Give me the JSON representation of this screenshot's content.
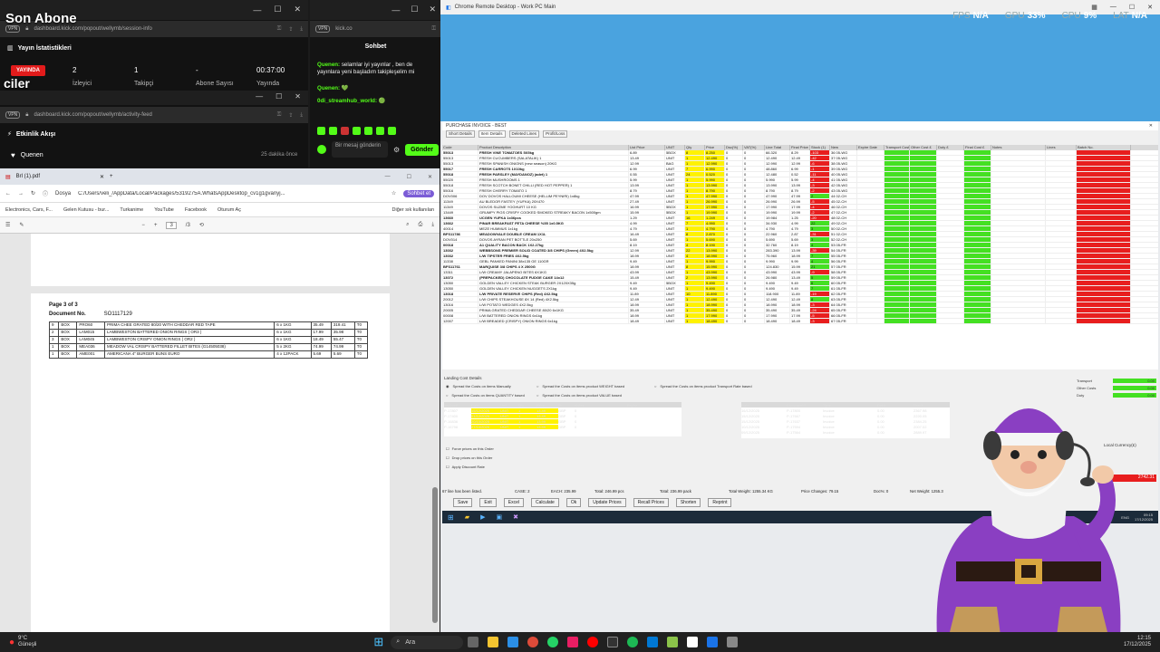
{
  "overlay": {
    "title": "Son Abone",
    "title_sub": "ciler"
  },
  "stats_window": {
    "url": "dashboard.kick.com/popout/wellymb/session-info",
    "vpn": "VPN",
    "heading": "Yayın İstatistikleri",
    "live_badge": "YAYINDA",
    "viewers_value": "2",
    "viewers_label": "İzleyici",
    "followers_value": "1",
    "followers_label": "Takipçi",
    "subs_value": "-",
    "subs_label": "Abone Sayısı",
    "time_value": "00:37:00",
    "time_label": "Yayında"
  },
  "activity_window": {
    "url": "dashboard.kick.com/popout/wellymb/activity-feed",
    "vpn": "VPN",
    "heading": "Etkinlik Akışı",
    "user": "Quenen",
    "time_ago": "25 dakika önce"
  },
  "chat": {
    "vpn": "VPN",
    "url": "kick.co",
    "heading": "Sohbet",
    "messages": [
      {
        "user": "Quenen:",
        "text": " selamlar iyi yayınlar , ben de yayınlara yeni başladım takipleşelim mi"
      },
      {
        "user": "Quenen:",
        "text": " 💚"
      },
      {
        "user": "0di_streamhub_world:",
        "text": " 🟢"
      }
    ],
    "input_placeholder": "Bir mesaj gönderin",
    "send_label": "Gönder"
  },
  "pdf": {
    "tab_title": "Brl (1).pdf",
    "address": "C:/Users/veli_/AppData/Local/Packages/5319275A.WhatsAppDesktop_cv1g1gvanyj...",
    "address_prefix": "Dosya",
    "chat_label": "Sohbet et",
    "bookmarks": [
      "Electronics, Cars, F...",
      "Gelen Kutusu - bur...",
      "Turkanime",
      "YouTube",
      "Facebook",
      "Oturum Aç"
    ],
    "other_bookmarks": "Diğer sık kullanılan",
    "page_input": "3",
    "page_total": "/3",
    "page_heading": "Page 3 of 3",
    "doc_label": "Document No.",
    "doc_number": "SO1117129",
    "rows": [
      [
        "9",
        "BOX",
        "PRO60",
        "PRIMA CHEE GRATED 80/20 WITH CHEDDAR RED TAPE",
        "6 x 1KG",
        "35.49",
        "319.41",
        "T0"
      ],
      [
        "2",
        "BOX",
        "LAM015",
        "LAMBWESTON BATTERED ONION RINGS ( OR3 )",
        "6 x 1KG",
        "17.99",
        "35.98",
        "T0"
      ],
      [
        "3",
        "BOX",
        "LAM045",
        "LAMBWESTON CRISPY ONION RINGS ( OR2 )",
        "6 x 1KG",
        "18.49",
        "55.47",
        "T0"
      ],
      [
        "1",
        "BOX",
        "MEA036",
        "MEADOW VAL CRISPY BATTERED FILLET BITES (G14505038)",
        "5 x 2KG",
        "74.99",
        "74.99",
        "T0"
      ],
      [
        "1",
        "BOX",
        "AME001",
        "AMERICANA 4\" BURGER BUNS EURO",
        "4 x 12PACK",
        "5.69",
        "5.69",
        "T0"
      ]
    ]
  },
  "crd": {
    "title": "Chrome Remote Desktop - Work PC Main",
    "hud": {
      "fps_label": "FPS",
      "fps_value": "N/A",
      "gpu_label": "GPU",
      "gpu_value": "33%",
      "cpu_label": "CPU",
      "cpu_value": "9%",
      "lat_label": "LAT",
      "lat_value": "N/A"
    },
    "invoice_title": "PURCHASE INVOICE - BEST",
    "tabs": [
      "Short Details",
      "Item Details",
      "Deleted Lines",
      "Profit/Loss"
    ],
    "columns": [
      "Code",
      "Product Description",
      "List Price",
      "UNIT",
      "Qty",
      "Price",
      "Dsc(%)",
      "VAT(%)",
      "Line Total",
      "Final Price",
      "Stock (1)",
      "New",
      "Expire Date",
      "Transport Cost £",
      "Other Cost £",
      "Duty £",
      "Final Cost £",
      "Notes",
      "Lines",
      "Batch No."
    ],
    "items": [
      [
        "55013",
        "FRESH VINE TOMATOES 5X5kg",
        "6.89",
        "5BOX",
        "8",
        "8.250",
        "0",
        "0",
        "66.320",
        "8.29",
        "-103",
        "36 05-WG"
      ],
      [
        "55013",
        "FRESH CUCUMBERS (SALATALIK) 1",
        "13.49",
        "UNIT",
        "1",
        "12.490",
        "0",
        "0",
        "12.490",
        "12.49",
        "-42",
        "37 05-WG"
      ],
      [
        "55013",
        "FRESH SPANISH ONIONS (new season) 20KG",
        "12.99",
        "BAG",
        "1",
        "12.990",
        "0",
        "0",
        "12.990",
        "12.99",
        "-6",
        "38 05-WG"
      ],
      [
        "55017",
        "FRESH CARROTS 1X10kg",
        "6.99",
        "UNIT",
        "7",
        "6.990",
        "0",
        "0",
        "48.860",
        "6.99",
        "-1",
        "39 05-WG"
      ],
      [
        "55018",
        "FRESH PARSLEY (MAYDANOZ) (adet) 1",
        "0.55",
        "UNIT",
        "24",
        "0.520",
        "0",
        "0",
        "12.480",
        "0.52",
        "-11",
        "40 05-WG"
      ],
      [
        "55020",
        "FRESH MUSHROOMS 1",
        "5.99",
        "UNIT",
        "1",
        "5.990",
        "0",
        "0",
        "5.990",
        "5.99",
        "-4",
        "41 05-WG"
      ],
      [
        "55018",
        "FRESH SCOTCH BONET CHILLI (RED HOT PEPPER) 1",
        "13.99",
        "UNIT",
        "1",
        "13.990",
        "0",
        "0",
        "13.990",
        "13.99",
        "-3",
        "42 05-WG"
      ],
      [
        "55016",
        "FRESH CHERRY TOMATO 1",
        "8.79",
        "UNIT",
        "1",
        "8.790",
        "0",
        "0",
        "8.790",
        "8.79",
        "-2",
        "43 05-WG"
      ],
      [
        "DOV006",
        "DOV DOVOS HALLOUMI CHEESE (HELLIM PEYNIRI) 1x8kg",
        "47.99",
        "UNIT",
        "1",
        "47.990",
        "0",
        "0",
        "47.990",
        "47.99",
        "2",
        "44 02-CH"
      ],
      [
        "11349",
        "AU BLEDOR FASTEY (YUFKA) 20X470",
        "27.49",
        "UNIT",
        "1",
        "26.990",
        "0",
        "0",
        "26.990",
        "26.99",
        "-5",
        "45 02-CH"
      ],
      [
        "11349",
        "DOVOS SUZME YOGHURT 10 KG",
        "16.99",
        "5BOX",
        "1",
        "17.990",
        "0",
        "0",
        "17.990",
        "17.99",
        "-4",
        "46 02-CH"
      ],
      [
        "13449",
        "GRUMPY PIGS CRISPY COOKED SMOKED STREAKY BACON 1x500gm",
        "15.99",
        "5BOX",
        "1",
        "19.990",
        "0",
        "0",
        "19.990",
        "19.99",
        "-2",
        "47 02-CH"
      ],
      [
        "13660",
        "UCGEN YUFKA 1x36pcs",
        "1.29",
        "UNIT",
        "16",
        "1.249",
        "0",
        "0",
        "19.984",
        "1.25",
        "-20",
        "48 02-CH"
      ],
      [
        "13662",
        "PINAR BREAKFAST FETA CHEESE %55 1x0.5KG",
        "4.99",
        "UNIT",
        "7",
        "4.990",
        "0",
        "0",
        "34.930",
        "4.99",
        "22",
        "49 02-CH"
      ],
      [
        "40014",
        "MEZE HUMMUS 1x1kg",
        "4.79",
        "UNIT",
        "1",
        "4.790",
        "0",
        "0",
        "4.790",
        "4.79",
        "3",
        "50 02-CH"
      ],
      [
        "BFS11786",
        "MEADOWVALE DOUBLE CREAM 1X1L",
        "16.49",
        "UNIT",
        "8",
        "2.870",
        "0",
        "0",
        "22.960",
        "2.87",
        "-31",
        "51 02-CH"
      ],
      [
        "DOV014",
        "DOVOS AYRAN PET BOTTLE 20x250",
        "5.69",
        "UNIT",
        "1",
        "5.690",
        "0",
        "0",
        "5.690",
        "5.69",
        "3",
        "52 02-CH"
      ],
      [
        "00018",
        "A1 QUALITY BACON BACK 1X2.27kg",
        "8.19",
        "UNIT",
        "4",
        "8.190",
        "0",
        "0",
        "32.760",
        "8.19",
        "4",
        "53 05-FR"
      ],
      [
        "13032",
        "WEBBSONS PREMIER SOLID COATED 3/8 CHIPS (Green) 4X2.5kg",
        "12.99",
        "UNIT",
        "22",
        "13.990",
        "0",
        "0",
        "283.390",
        "13.99",
        "-39",
        "54 05-FR"
      ],
      [
        "13032",
        "L/W TIPSTER FRIES 4X2.5kg",
        "18.99",
        "UNIT",
        "4",
        "18.990",
        "0",
        "0",
        "75.960",
        "18.99",
        "7",
        "55 05-FR"
      ],
      [
        "11338",
        "GEBL PANKED PANINI 38x135 GE 110GR",
        "9.49",
        "UNIT",
        "1",
        "9.990",
        "0",
        "0",
        "9.990",
        "9.99",
        "4",
        "56 05-FR"
      ],
      [
        "BFS11761",
        "MARQUISE 3/8 CHIPS 4 X 2500G",
        "18.99",
        "UNIT",
        "8",
        "15.990",
        "0",
        "0",
        "124.830",
        "15.99",
        "21",
        "57 05-FR"
      ],
      [
        "13311",
        "L/W CREAMY JALAPENO BITES 6X1KG",
        "43.99",
        "UNIT",
        "1",
        "43.990",
        "0",
        "0",
        "43.990",
        "43.99",
        "-9",
        "58 05-FR"
      ],
      [
        "13072",
        "(PREPACKED) CHOCOLATE FUDGE CAKE 14x12",
        "15.49",
        "UNIT",
        "2",
        "13.990",
        "0",
        "0",
        "26.980",
        "13.49",
        "5",
        "59 05-FR"
      ],
      [
        "13050",
        "GOLDEN VALLEY CHICKEN STEAK BURGER 2X120X35g",
        "9.49",
        "5BOX",
        "1",
        "9.490",
        "0",
        "0",
        "9.490",
        "9.49",
        "6",
        "60 05-FR"
      ],
      [
        "13050",
        "GOLDEN VALLEY CHICKEN NUGGETS 2X1kg",
        "9.49",
        "UNIT",
        "1",
        "9.490",
        "0",
        "0",
        "9.490",
        "9.49",
        "7",
        "61 05-FR"
      ],
      [
        "13018",
        "L/W PRIVATE RESERVE CHIPS (Red) 4X2.5kg",
        "11.89",
        "UNIT",
        "10",
        "11.890",
        "0",
        "0",
        "118.900",
        "11.89",
        "-19",
        "62 05-FR"
      ],
      [
        "20012",
        "L/W CHIPS STEAKHOUSE 8X 14 (Red) 4X2.5kg",
        "12.49",
        "UNIT",
        "1",
        "12.490",
        "0",
        "0",
        "12.490",
        "12.49",
        "8",
        "63 05-FR"
      ],
      [
        "13016",
        "L/W POTATO WEDGES 4X2.5kg",
        "18.99",
        "UNIT",
        "1",
        "18.990",
        "0",
        "0",
        "18.990",
        "18.99",
        "-3",
        "64 05-FR"
      ],
      [
        "20005",
        "PRIMA GRATED CHEDDAR CHEESE 80/20 6x1KG",
        "35.49",
        "UNIT",
        "1",
        "35.490",
        "0",
        "0",
        "35.490",
        "35.49",
        "-24",
        "65 05-FR"
      ],
      [
        "00008",
        "L/W BATTERED ONION RINGS 6x1kg",
        "18.99",
        "UNIT",
        "1",
        "17.990",
        "0",
        "0",
        "17.990",
        "17.99",
        "-5",
        "66 05-FR"
      ],
      [
        "12007",
        "L/W BREADED (CRISPY) ONION RINGS 6x1kg",
        "18.49",
        "UNIT",
        "1",
        "18.490",
        "0",
        "0",
        "18.490",
        "18.49",
        "-3",
        "67 05-FR"
      ]
    ],
    "landing_label": "Landing Cost Details",
    "spread_options": [
      "Spread the Costs on items Manually",
      "Spread the Costs on items product WEIGHT based",
      "Spread the Costs on items product Transport Rate based",
      "Spread the Costs on items QUANTITY based",
      "Spread the Costs on items product VALUE based"
    ],
    "cost_labels": [
      "Transport",
      "Other Costs",
      "Duty"
    ],
    "cost_values": [
      "0.00",
      "0.00",
      "0.00"
    ],
    "sub_columns": [
      "Invoice#",
      "Date",
      "Unit",
      "Qty",
      "Price",
      "%",
      "Notes",
      "Expire"
    ],
    "sub_rows": [
      [
        "P-17807",
        "15/12/2025",
        "UNIT",
        "1",
        "13.49",
        "GBP",
        "0"
      ],
      [
        "P-17400",
        "01/12/2025",
        "UNIT",
        "1",
        "13.49",
        "GBP",
        "0"
      ],
      [
        "P-16836",
        "20/10/2025",
        "UNIT",
        "1",
        "13.99",
        "GBP",
        "0"
      ],
      [
        "P-16798",
        "27/10/2025",
        "UNIT",
        "1",
        "13.99",
        "GBP",
        "0"
      ]
    ],
    "doc_columns": [
      "Date",
      "Document#",
      "Type",
      "Debit",
      "Credit"
    ],
    "doc_rows": [
      [
        "16/12/2025",
        "P-17800",
        "Invoice",
        "0.00",
        "2367.98"
      ],
      [
        "15/12/2025",
        "P-17667",
        "Invoice",
        "0.00",
        "2220.05"
      ],
      [
        "15/12/2025",
        "P-17637",
        "Invoice",
        "0.00",
        "2384.25"
      ],
      [
        "10/12/2025",
        "P-17594",
        "Invoice",
        "0.00",
        "2007.02"
      ],
      [
        "09/12/2025",
        "P-17564",
        "Invoice",
        "0.00",
        "2889.97"
      ]
    ],
    "checkboxes": [
      "Force prices on this Order",
      "Drop prices on this Order",
      "Apply Discount Rate"
    ],
    "local_currency_label": "Local Currency(£)",
    "local_total": "2742.31",
    "status": {
      "lines": "67 line has been listed.",
      "case": "CASE: 2",
      "each": "EACH: 235.99",
      "total": "Total: 246.99 pcs",
      "total2": "Total: 236.99 pack",
      "weight": "Total Weight: 1255.34 KG",
      "price_changes": "Price Changes: 79.15",
      "doc": "Doc%: 0",
      "net": "Net Weight: 1255.3"
    },
    "buttons": [
      "Save",
      "Exit",
      "Excel",
      "Calculate",
      "Ok",
      "Update Prices",
      "Recall Prices",
      "Shorten",
      "Reprint"
    ],
    "remote_clock": "09:15",
    "remote_date": "17/12/2025",
    "remote_lang": "ENG"
  },
  "taskbar": {
    "weather": "9°C",
    "weather_sub": "Güneşli",
    "search": "Ara",
    "time": "12:15",
    "date": "17/12/2025"
  },
  "colors": {
    "kick_green": "#53fc18",
    "live_red": "#e21b1b",
    "cell_yellow": "#fff200",
    "cell_green": "#44e022",
    "cell_red": "#e81e1e"
  }
}
